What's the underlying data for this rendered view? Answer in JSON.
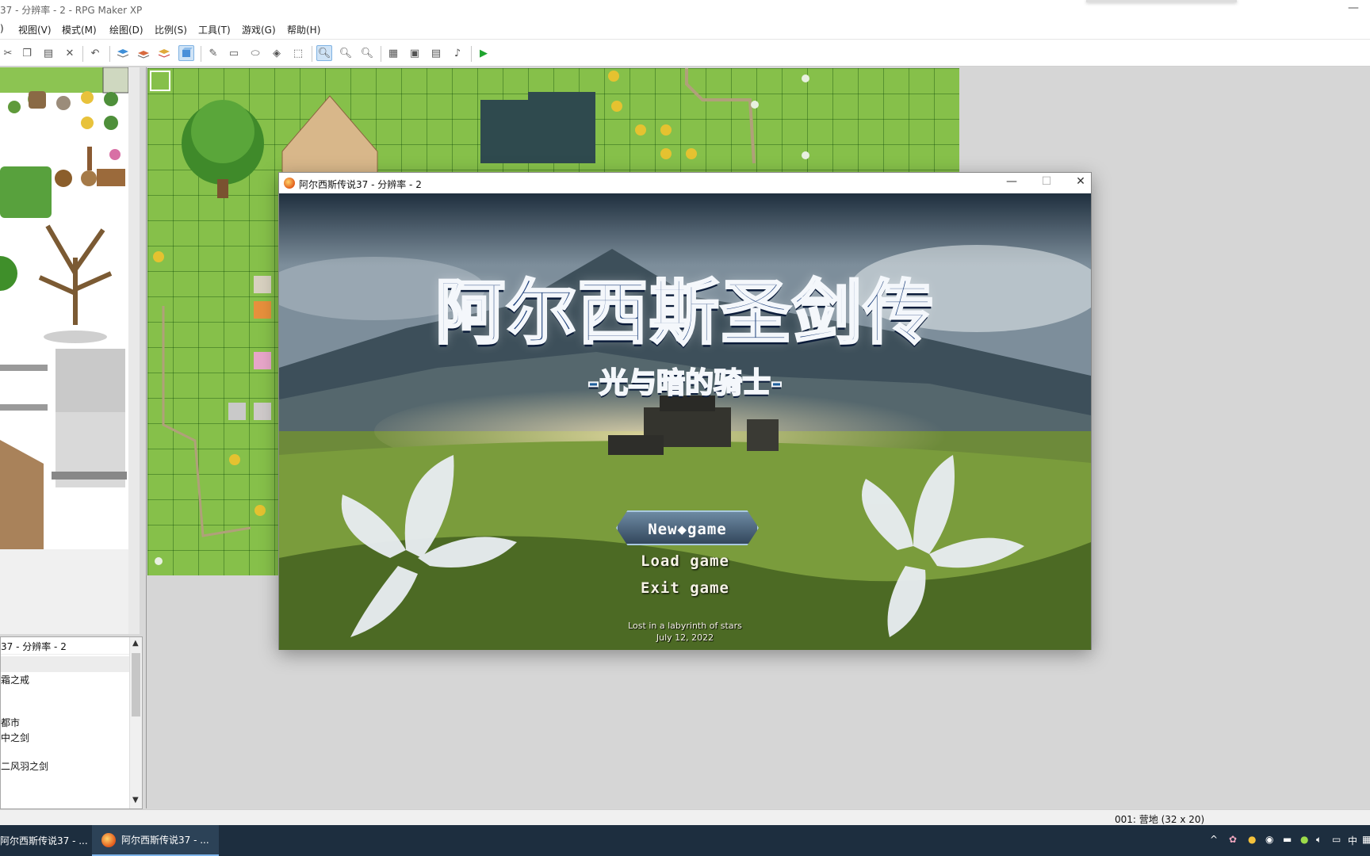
{
  "main_window": {
    "title": "37 - 分辨率 - 2 - RPG Maker XP",
    "minimize_glyph": "—"
  },
  "menubar": {
    "items": [
      ")",
      "视图(V)",
      "模式(M)",
      "绘图(D)",
      "比例(S)",
      "工具(T)",
      "游戏(G)",
      "帮助(H)"
    ]
  },
  "toolbar": {
    "icons": [
      "scissors-icon",
      "copy-icon",
      "paste-icon",
      "delete-icon",
      "undo-icon",
      "layer1-icon",
      "layer2-icon",
      "layer3-icon",
      "event-layer-icon",
      "pencil-icon",
      "rectangle-icon",
      "ellipse-icon",
      "fill-icon",
      "select-icon",
      "zoom-1-1-icon",
      "zoom-1-2-icon",
      "zoom-1-4-icon",
      "database-icon",
      "material-icon",
      "script-icon",
      "sound-icon",
      "playtest-icon"
    ]
  },
  "maptree": {
    "header": "37 - 分辨率 - 2",
    "items": [
      "霜之戒",
      "都市",
      "中之剑",
      "二风羽之剑"
    ]
  },
  "game_window": {
    "title": "阿尔西斯传说37 - 分辨率 - 2",
    "minimize": "—",
    "maximize": "☐",
    "close": "✕"
  },
  "game_screen": {
    "title": "阿尔西斯圣剑传",
    "subtitle": "-光与暗的骑士-",
    "menu": {
      "new_game": "New◆game",
      "load_game": "Load game",
      "exit_game": "Exit  game"
    },
    "footer_line1": "Lost in a labyrinth of stars",
    "footer_line2": "July 12, 2022"
  },
  "statusbar": {
    "text": "001: 营地 (32 x 20)"
  },
  "taskbar": {
    "items": [
      "阿尔西斯传说37 - ...",
      "阿尔西斯传说37 - ..."
    ],
    "tray": [
      "^",
      "中"
    ]
  },
  "colors": {
    "accent": "#7db4ea",
    "grass": "#86c04a",
    "taskbar": "#1d2e3f",
    "title_blue": "#1c3f7a"
  }
}
